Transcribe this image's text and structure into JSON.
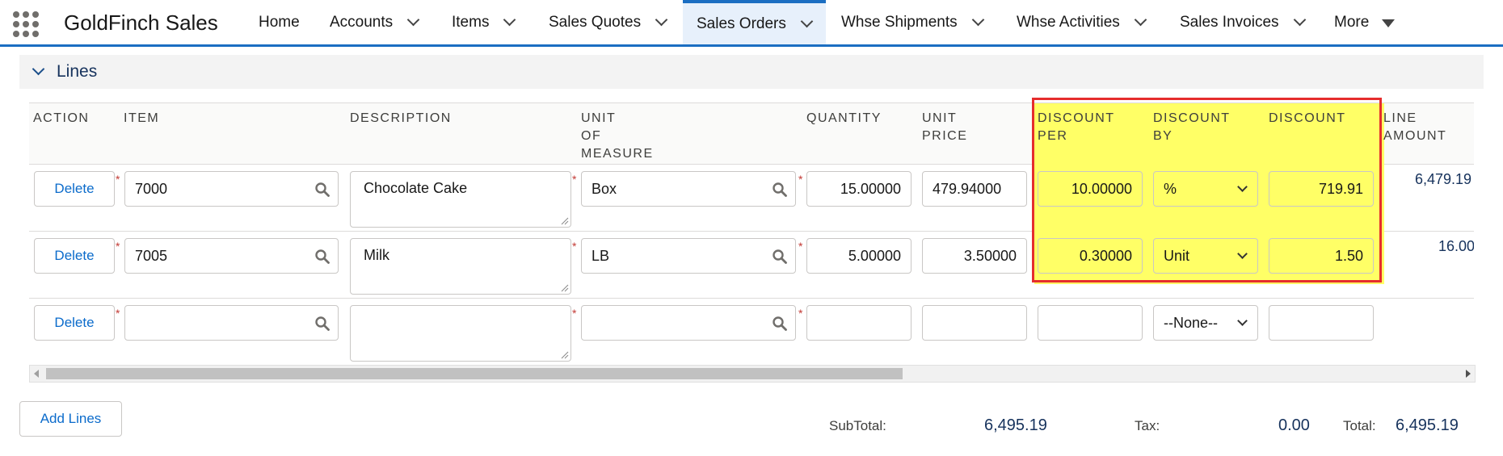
{
  "header": {
    "app_name": "GoldFinch Sales",
    "nav": [
      {
        "label": "Home"
      },
      {
        "label": "Accounts"
      },
      {
        "label": "Items"
      },
      {
        "label": "Sales Quotes"
      },
      {
        "label": "Sales Orders"
      },
      {
        "label": "Whse Shipments"
      },
      {
        "label": "Whse Activities"
      },
      {
        "label": "Sales Invoices"
      },
      {
        "label": "More"
      }
    ],
    "active_tab": "Sales Orders"
  },
  "section": {
    "title": "Lines"
  },
  "table": {
    "headers": {
      "action": "ACTION",
      "item": "ITEM",
      "description": "DESCRIPTION",
      "uom_1": "UNIT",
      "uom_2": "OF",
      "uom_3": "MEASURE",
      "qty": "QUANTITY",
      "price_1": "UNIT",
      "price_2": "PRICE",
      "discper_1": "DISCOUNT",
      "discper_2": "PER",
      "discby_1": "DISCOUNT",
      "discby_2": "BY",
      "discount": "DISCOUNT",
      "amount_1": "LINE",
      "amount_2": "AMOUNT"
    },
    "rows": [
      {
        "action": "Delete",
        "item": "7000",
        "description": "Chocolate Cake",
        "uom": "Box",
        "quantity": "15.00000",
        "unit_price": "479.94000",
        "discount_per": "10.00000",
        "discount_by": "%",
        "discount": "719.91",
        "line_amount": "6,479.19"
      },
      {
        "action": "Delete",
        "item": "7005",
        "description": "Milk",
        "uom": "LB",
        "quantity": "5.00000",
        "unit_price": "3.50000",
        "discount_per": "0.30000",
        "discount_by": "Unit",
        "discount": "1.50",
        "line_amount": "16.00"
      },
      {
        "action": "Delete",
        "item": "",
        "description": "",
        "uom": "",
        "quantity": "",
        "unit_price": "",
        "discount_per": "",
        "discount_by": "--None--",
        "discount": "",
        "line_amount": ""
      }
    ]
  },
  "footer": {
    "add_lines": "Add Lines",
    "subtotal_label": "SubTotal:",
    "subtotal": "6,495.19",
    "tax_label": "Tax:",
    "tax": "0.00",
    "total_label": "Total:",
    "total": "6,495.19"
  },
  "colors": {
    "accent": "#1b6ec2",
    "highlight": "#ffff66",
    "highlight_border": "#e52d2d",
    "link": "#0b6bcb"
  }
}
